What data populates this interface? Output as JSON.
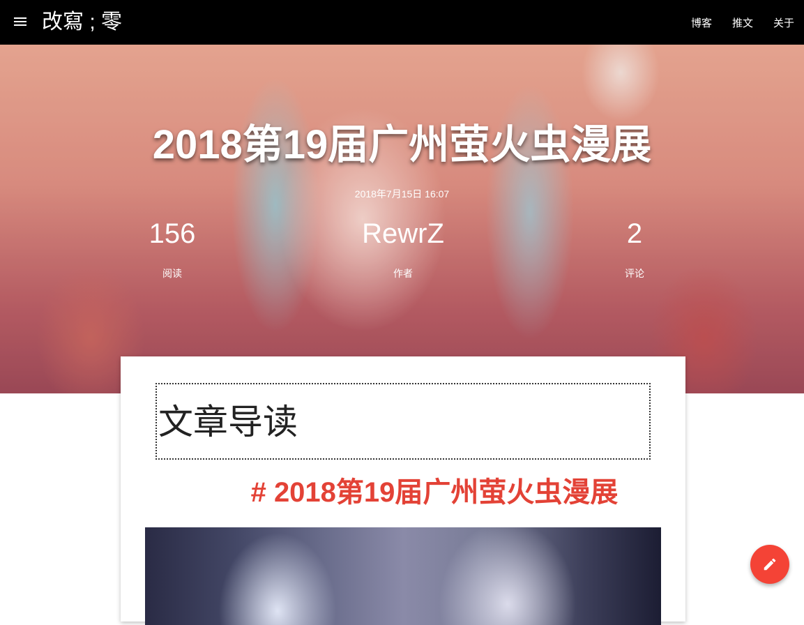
{
  "appbar": {
    "site_title": "改寫 ; 零",
    "nav": [
      "博客",
      "推文",
      "关于"
    ]
  },
  "hero": {
    "title": "2018第19届广州萤火虫漫展",
    "date": "2018年7月15日 16:07",
    "stats": {
      "views_value": "156",
      "views_label": "阅读",
      "author_value": "RewrZ",
      "author_label": "作者",
      "comments_value": "2",
      "comments_label": "评论"
    }
  },
  "article": {
    "toc_title": "文章导读",
    "heading": "# 2018第19届广州萤火虫漫展"
  },
  "icons": {
    "menu": "menu-icon",
    "fab": "pencil-icon"
  },
  "colors": {
    "appbar": "#000000",
    "accent": "#f44336",
    "heading": "#e34236"
  }
}
